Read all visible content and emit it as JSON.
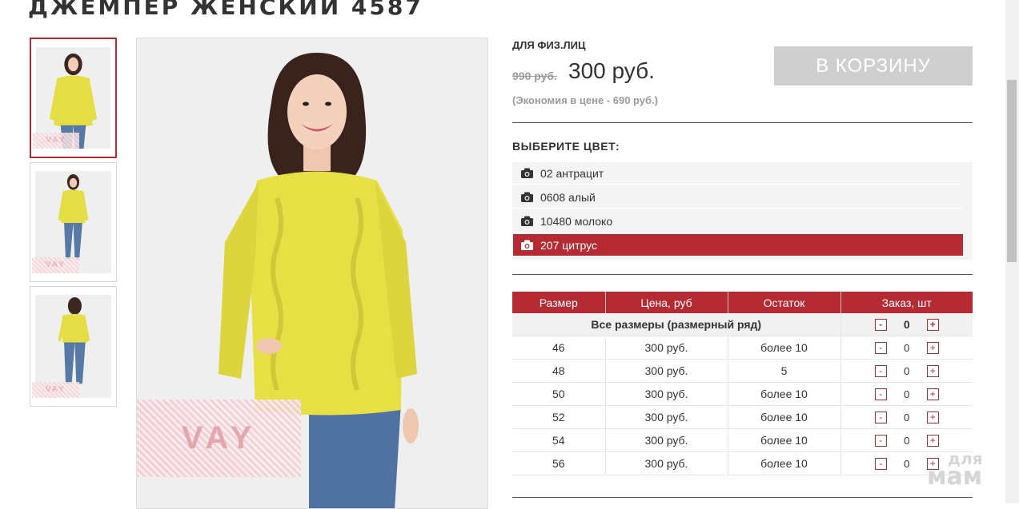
{
  "product": {
    "title": "ДЖЕМПЕР ЖЕНСКИЙ 4587",
    "customer_type": "ДЛЯ ФИЗ.ЛИЦ",
    "old_price": "990 руб.",
    "price": "300 руб.",
    "economy": "(Экономия в цене - 690 руб.)",
    "cart_button": "В КОРЗИНУ",
    "watermark": "VAY"
  },
  "colors": {
    "heading": "ВЫБЕРИТЕ ЦВЕТ:",
    "items": [
      {
        "label": "02 антрацит",
        "selected": false
      },
      {
        "label": "0608 алый",
        "selected": false
      },
      {
        "label": "10480 молоко",
        "selected": false
      },
      {
        "label": "207 цитрус",
        "selected": true
      }
    ]
  },
  "sizes_table": {
    "headers": [
      "Размер",
      "Цена, руб",
      "Остаток",
      "Заказ, шт"
    ],
    "all_sizes": {
      "label": "Все размеры (размерный ряд)",
      "qty": "0"
    },
    "rows": [
      {
        "size": "46",
        "price": "300 руб.",
        "stock": "более 10",
        "qty": "0"
      },
      {
        "size": "48",
        "price": "300 руб.",
        "stock": "5",
        "qty": "0"
      },
      {
        "size": "50",
        "price": "300 руб.",
        "stock": "более 10",
        "qty": "0"
      },
      {
        "size": "52",
        "price": "300 руб.",
        "stock": "более 10",
        "qty": "0"
      },
      {
        "size": "54",
        "price": "300 руб.",
        "stock": "более 10",
        "qty": "0"
      },
      {
        "size": "56",
        "price": "300 руб.",
        "stock": "более 10",
        "qty": "0"
      }
    ],
    "minus": "-",
    "plus": "+"
  },
  "site_watermark": {
    "line1": "для",
    "line2": "мам"
  },
  "colors_palette": {
    "accent": "#b52a33",
    "button_disabled": "#cfcfcf",
    "sweater": "#e6e045"
  }
}
